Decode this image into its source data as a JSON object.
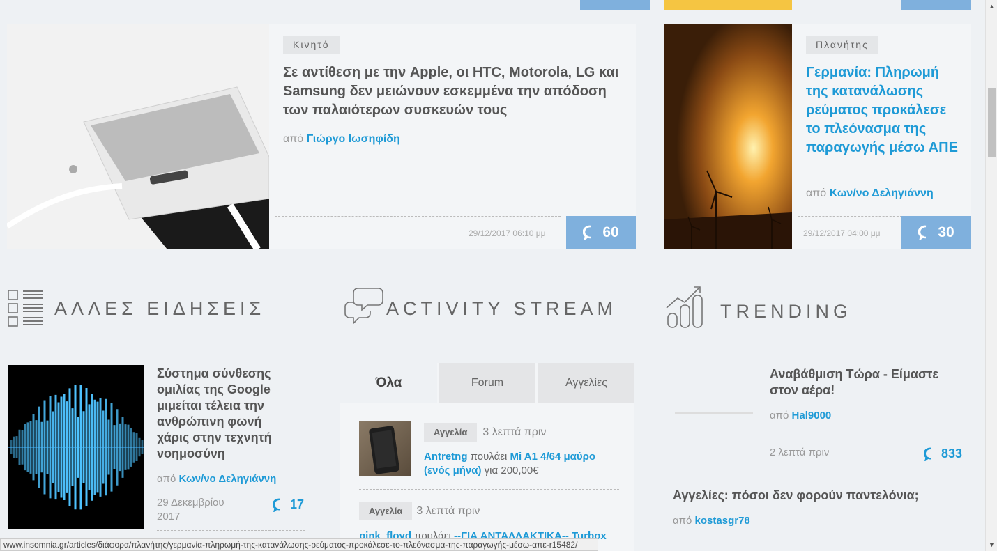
{
  "featured": [
    {
      "category": "Κινητό",
      "title": "Σε αντίθεση με την Apple, οι HTC, Motorola, LG και Samsung δεν μειώνουν εσκεμμένα την απόδοση των παλαιότερων συσκευών τους",
      "by_prefix": "από",
      "author": "Γιώργο Ιωσηφίδη",
      "date": "29/12/2017 06:10 μμ",
      "comments": "60"
    },
    {
      "category": "Πλανήτης",
      "title": "Γερμανία: Πληρωμή της κατανάλωσης ρεύματος προκάλεσε το πλεόνασμα της παραγωγής μέσω ΑΠΕ",
      "by_prefix": "από",
      "author": "Κων/νο Δεληγιάννη",
      "date": "29/12/2017 04:00 μμ",
      "comments": "30"
    }
  ],
  "sections": {
    "other_news": "ΑΛΛΕΣ ΕΙΔΗΣΕΙΣ",
    "activity": "ACTIVITY STREAM",
    "trending": "TRENDING"
  },
  "other_news_item": {
    "title": "Σύστημα σύνθεσης ομιλίας της Google μιμείται τέλεια την ανθρώπινη φωνή χάρις στην τεχνητή νοημοσύνη",
    "by_prefix": "από",
    "author": "Κων/νο Δεληγιάννη",
    "date": "29 Δεκεμβρίου 2017",
    "comments": "17"
  },
  "activity": {
    "tabs": [
      "Όλα",
      "Forum",
      "Αγγελίες"
    ],
    "items": [
      {
        "tag": "Αγγελία",
        "ago": "3 λεπτά πριν",
        "user": "Antretng",
        "verb": "πουλάει",
        "item": "Mi A1 4/64 μαύρο (ενός μήνα)",
        "price_prefix": "για",
        "price": "200,00€"
      },
      {
        "tag": "Αγγελία",
        "ago": "3 λεπτά πριν",
        "user": "pink_floyd",
        "verb": "πουλάει",
        "item": "--ΓΙΑ ΑΝΤΑΛΛΑΚΤΙΚΑ-- Turbox"
      }
    ]
  },
  "trending": [
    {
      "title": "Αναβάθμιση Τώρα - Είμαστε στον αέρα!",
      "by_prefix": "από",
      "author": "Hal9000",
      "ago": "2 λεπτά πριν",
      "comments": "833"
    },
    {
      "title": "Αγγελίες: πόσοι δεν φορούν παντελόνια;",
      "by_prefix": "από",
      "author": "kostasgr78"
    }
  ],
  "status_url": "www.insomnia.gr/articles/διάφορα/πλανήτης/γερμανία-πληρωμή-της-κατανάλωσης-ρεύματος-προκάλεσε-το-πλεόνασμα-της-παραγωγής-μέσω-απε-r15482/"
}
